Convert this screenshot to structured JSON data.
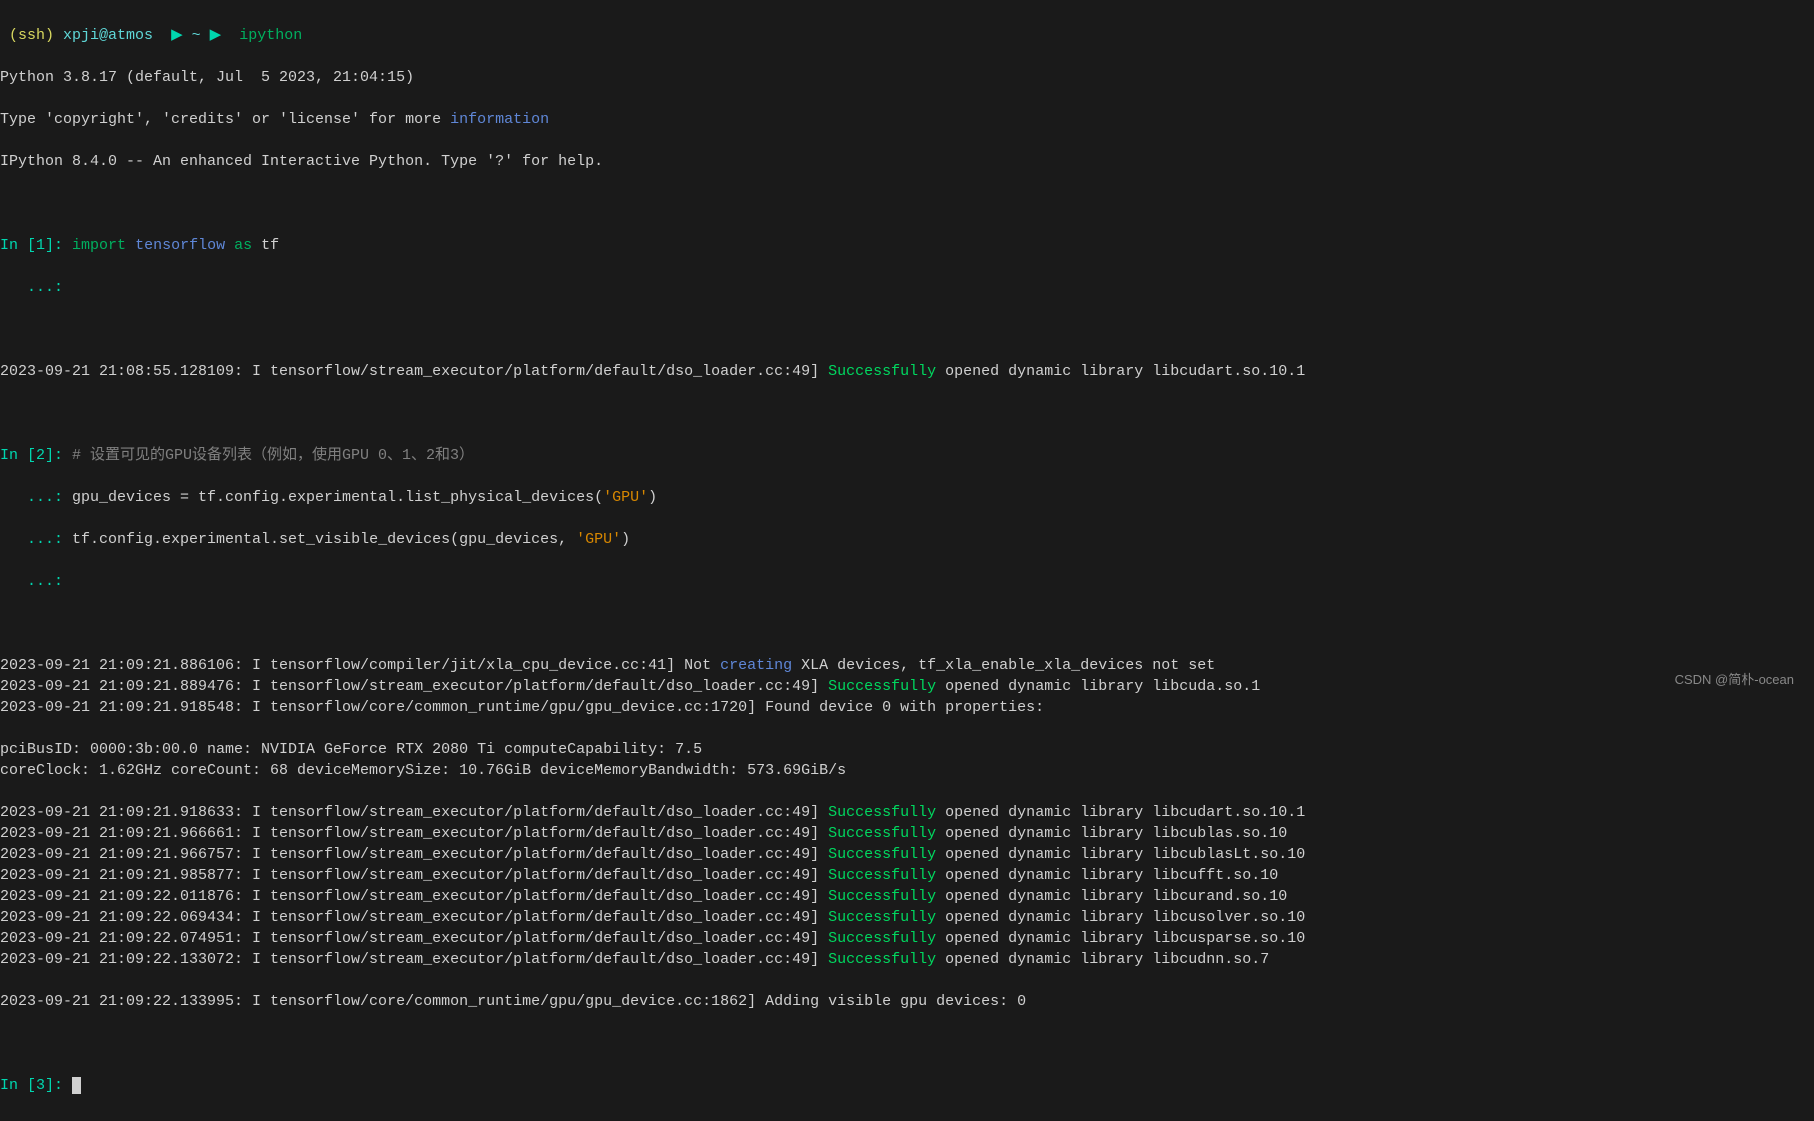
{
  "prompt": {
    "ssh_prefix": "(ssh)",
    "user_host": "xpji@atmos",
    "tilde": "~",
    "arrow": "▶",
    "command": "ipython"
  },
  "python_version_line": "Python 3.8.17 (default, Jul  5 2023, 21:04:15)",
  "type_line_prefix": "Type 'copyright', 'credits' or 'license' for more ",
  "type_line_link": "information",
  "ipython_line": "IPython 8.4.0 -- An enhanced Interactive Python. Type '?' for help.",
  "in1": {
    "label": "In [1]:",
    "import_kw": "import",
    "module": "tensorflow",
    "as_kw": "as",
    "alias": "tf",
    "cont": "   ...:"
  },
  "log1": {
    "ts": "2023-09-21 21:08:55.128109: I tensorflow/stream_executor/platform/default/dso_loader.cc:49] ",
    "success": "Successfully",
    "tail": " opened dynamic library libcudart.so.10.1"
  },
  "in2": {
    "label": "In [2]:",
    "comment": "# 设置可见的GPU设备列表（例如，使用GPU 0、1、2和3）",
    "cont": "   ...:",
    "line2a": " gpu_devices = tf.config.experimental.list_physical_devices(",
    "line2a_str": "'GPU'",
    "line2a_end": ")",
    "line3a": " tf.config.experimental.set_visible_devices(gpu_devices, ",
    "line3a_str": "'GPU'",
    "line3a_end": ")"
  },
  "logs": [
    {
      "ts": "2023-09-21 21:09:21.886106: I tensorflow/compiler/jit/xla_cpu_device.cc:41] Not ",
      "mid": "creating",
      "tail": " XLA devices, tf_xla_enable_xla_devices not set",
      "midclass": "blue"
    },
    {
      "ts": "2023-09-21 21:09:21.889476: I tensorflow/stream_executor/platform/default/dso_loader.cc:49] ",
      "mid": "Successfully",
      "tail": " opened dynamic library libcuda.so.1",
      "midclass": "brightgreen"
    },
    {
      "ts": "2023-09-21 21:09:21.918548: I tensorflow/core/common_runtime/gpu/gpu_device.cc:1720] Found device 0 with properties:",
      "mid": "",
      "tail": "",
      "midclass": ""
    }
  ],
  "device_lines": [
    "pciBusID: 0000:3b:00.0 name: NVIDIA GeForce RTX 2080 Ti computeCapability: 7.5",
    "coreClock: 1.62GHz coreCount: 68 deviceMemorySize: 10.76GiB deviceMemoryBandwidth: 573.69GiB/s"
  ],
  "success_logs": [
    {
      "ts": "2023-09-21 21:09:21.918633: I tensorflow/stream_executor/platform/default/dso_loader.cc:49] ",
      "tail": " opened dynamic library libcudart.so.10.1"
    },
    {
      "ts": "2023-09-21 21:09:21.966661: I tensorflow/stream_executor/platform/default/dso_loader.cc:49] ",
      "tail": " opened dynamic library libcublas.so.10"
    },
    {
      "ts": "2023-09-21 21:09:21.966757: I tensorflow/stream_executor/platform/default/dso_loader.cc:49] ",
      "tail": " opened dynamic library libcublasLt.so.10"
    },
    {
      "ts": "2023-09-21 21:09:21.985877: I tensorflow/stream_executor/platform/default/dso_loader.cc:49] ",
      "tail": " opened dynamic library libcufft.so.10"
    },
    {
      "ts": "2023-09-21 21:09:22.011876: I tensorflow/stream_executor/platform/default/dso_loader.cc:49] ",
      "tail": " opened dynamic library libcurand.so.10"
    },
    {
      "ts": "2023-09-21 21:09:22.069434: I tensorflow/stream_executor/platform/default/dso_loader.cc:49] ",
      "tail": " opened dynamic library libcusolver.so.10"
    },
    {
      "ts": "2023-09-21 21:09:22.074951: I tensorflow/stream_executor/platform/default/dso_loader.cc:49] ",
      "tail": " opened dynamic library libcusparse.so.10"
    },
    {
      "ts": "2023-09-21 21:09:22.133072: I tensorflow/stream_executor/platform/default/dso_loader.cc:49] ",
      "tail": " opened dynamic library libcudnn.so.7"
    }
  ],
  "success_word": "Successfully",
  "final_log": "2023-09-21 21:09:22.133995: I tensorflow/core/common_runtime/gpu/gpu_device.cc:1862] Adding visible gpu devices: 0",
  "in3": {
    "label": "In [3]:"
  },
  "watermark": "CSDN @简朴-ocean"
}
